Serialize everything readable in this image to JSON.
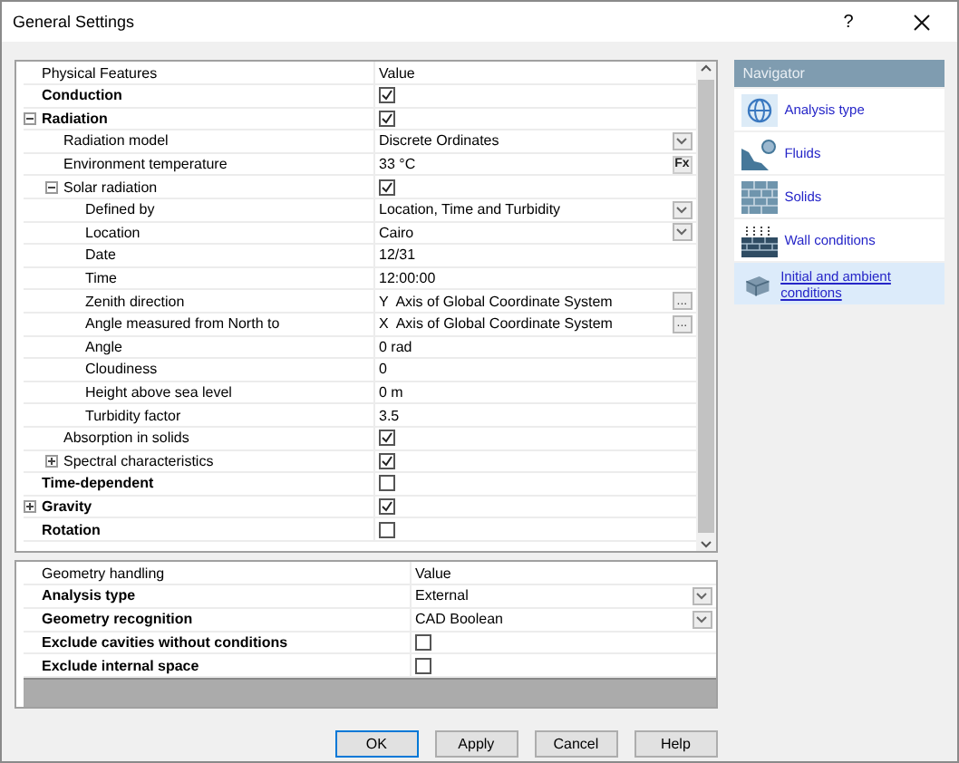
{
  "window": {
    "title": "General Settings",
    "help": "?"
  },
  "physical_grid": {
    "columns": [
      "Physical Features",
      "Value"
    ],
    "rows": [
      {
        "label": "Conduction",
        "bold": true,
        "kind": "check",
        "checked": true
      },
      {
        "label": "Radiation",
        "bold": true,
        "kind": "check",
        "checked": true,
        "expanded": true,
        "children": [
          {
            "label": "Radiation model",
            "bold": false,
            "kind": "dropdown",
            "value": "Discrete Ordinates"
          },
          {
            "label": "Environment temperature",
            "bold": false,
            "kind": "fx",
            "value": "33 °C",
            "button": "Fx"
          },
          {
            "label": "Solar radiation",
            "bold": false,
            "kind": "check",
            "checked": true,
            "expanded": true,
            "children": [
              {
                "label": "Defined by",
                "bold": false,
                "kind": "dropdown",
                "value": "Location, Time and Turbidity"
              },
              {
                "label": "Location",
                "bold": false,
                "kind": "dropdown",
                "value": "Cairo"
              },
              {
                "label": "Date",
                "bold": false,
                "kind": "text",
                "value": "12/31"
              },
              {
                "label": "Time",
                "bold": false,
                "kind": "text",
                "value": "12:00:00"
              },
              {
                "label": "Zenith direction",
                "bold": false,
                "kind": "ellipsis",
                "value": "Y  Axis of Global Coordinate System",
                "button": "..."
              },
              {
                "label": "Angle measured from North to",
                "bold": false,
                "kind": "ellipsis",
                "value": "X  Axis of Global Coordinate System",
                "button": "..."
              },
              {
                "label": "Angle",
                "bold": false,
                "kind": "text",
                "value": "0 rad"
              },
              {
                "label": "Cloudiness",
                "bold": false,
                "kind": "text",
                "value": "0"
              },
              {
                "label": "Height above sea level",
                "bold": false,
                "kind": "text",
                "value": "0 m"
              },
              {
                "label": "Turbidity factor",
                "bold": false,
                "kind": "text",
                "value": "3.5"
              }
            ]
          },
          {
            "label": "Absorption in solids",
            "bold": false,
            "kind": "check",
            "checked": true
          },
          {
            "label": "Spectral characteristics",
            "bold": false,
            "kind": "check",
            "checked": true,
            "expanded": false
          }
        ]
      },
      {
        "label": "Time-dependent",
        "bold": true,
        "kind": "check",
        "checked": false
      },
      {
        "label": "Gravity",
        "bold": true,
        "kind": "check",
        "checked": true,
        "expanded": false
      },
      {
        "label": "Rotation",
        "bold": true,
        "kind": "check",
        "checked": false
      }
    ]
  },
  "geometry_grid": {
    "columns": [
      "Geometry handling",
      "Value"
    ],
    "rows": [
      {
        "label": "Analysis type",
        "bold": true,
        "kind": "dropdown",
        "value": "External"
      },
      {
        "label": "Geometry recognition",
        "bold": true,
        "kind": "dropdown",
        "value": "CAD Boolean"
      },
      {
        "label": "Exclude cavities without conditions",
        "bold": true,
        "kind": "check",
        "checked": false
      },
      {
        "label": "Exclude internal space",
        "bold": true,
        "kind": "check",
        "checked": false
      }
    ]
  },
  "navigator": {
    "title": "Navigator",
    "items": [
      {
        "label": "Analysis type",
        "kind": "globe",
        "selected": false
      },
      {
        "label": "Fluids",
        "kind": "fluid",
        "selected": false
      },
      {
        "label": "Solids",
        "kind": "bricks",
        "selected": false
      },
      {
        "label": "Wall conditions",
        "kind": "wall",
        "selected": false
      },
      {
        "label": "Initial and ambient conditions",
        "kind": "cube",
        "selected": true
      }
    ]
  },
  "buttons": [
    {
      "label": "OK",
      "default": true
    },
    {
      "label": "Apply",
      "default": false
    },
    {
      "label": "Cancel",
      "default": false
    },
    {
      "label": "Help",
      "default": false
    }
  ]
}
